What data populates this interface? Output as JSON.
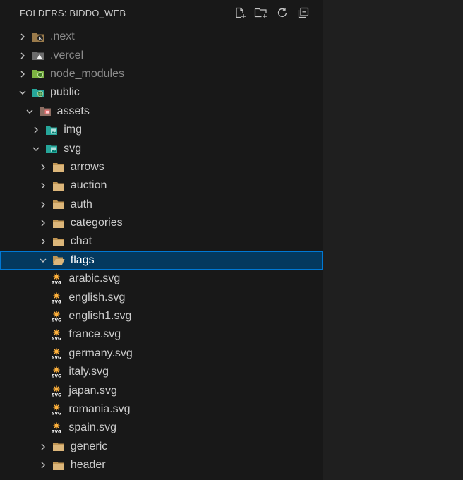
{
  "explorer": {
    "title": "FOLDERS: BIDDO_WEB",
    "actions": [
      {
        "name": "new-file-icon"
      },
      {
        "name": "new-folder-icon"
      },
      {
        "name": "refresh-icon"
      },
      {
        "name": "collapse-all-icon"
      }
    ]
  },
  "tree": [
    {
      "label": ".next",
      "depth": 0,
      "type": "folder",
      "expanded": false,
      "dimmed": true,
      "icon": "next-folder-icon"
    },
    {
      "label": ".vercel",
      "depth": 0,
      "type": "folder",
      "expanded": false,
      "dimmed": true,
      "icon": "vercel-folder-icon"
    },
    {
      "label": "node_modules",
      "depth": 0,
      "type": "folder",
      "expanded": false,
      "dimmed": true,
      "icon": "node-folder-icon"
    },
    {
      "label": "public",
      "depth": 0,
      "type": "folder",
      "expanded": true,
      "dimmed": false,
      "icon": "public-folder-icon"
    },
    {
      "label": "assets",
      "depth": 1,
      "type": "folder",
      "expanded": true,
      "dimmed": false,
      "icon": "assets-folder-icon"
    },
    {
      "label": "img",
      "depth": 2,
      "type": "folder",
      "expanded": false,
      "dimmed": false,
      "icon": "images-folder-icon"
    },
    {
      "label": "svg",
      "depth": 2,
      "type": "folder",
      "expanded": true,
      "dimmed": false,
      "icon": "images-folder-icon"
    },
    {
      "label": "arrows",
      "depth": 3,
      "type": "folder",
      "expanded": false,
      "dimmed": false,
      "icon": "folder-icon"
    },
    {
      "label": "auction",
      "depth": 3,
      "type": "folder",
      "expanded": false,
      "dimmed": false,
      "icon": "folder-icon"
    },
    {
      "label": "auth",
      "depth": 3,
      "type": "folder",
      "expanded": false,
      "dimmed": false,
      "icon": "folder-icon"
    },
    {
      "label": "categories",
      "depth": 3,
      "type": "folder",
      "expanded": false,
      "dimmed": false,
      "icon": "folder-icon"
    },
    {
      "label": "chat",
      "depth": 3,
      "type": "folder",
      "expanded": false,
      "dimmed": false,
      "icon": "folder-icon"
    },
    {
      "label": "flags",
      "depth": 3,
      "type": "folder",
      "expanded": true,
      "dimmed": false,
      "icon": "open-folder-icon",
      "selected": true
    },
    {
      "label": "arabic.svg",
      "depth": 4,
      "type": "file",
      "icon": "svg-file-icon"
    },
    {
      "label": "english.svg",
      "depth": 4,
      "type": "file",
      "icon": "svg-file-icon"
    },
    {
      "label": "english1.svg",
      "depth": 4,
      "type": "file",
      "icon": "svg-file-icon"
    },
    {
      "label": "france.svg",
      "depth": 4,
      "type": "file",
      "icon": "svg-file-icon"
    },
    {
      "label": "germany.svg",
      "depth": 4,
      "type": "file",
      "icon": "svg-file-icon"
    },
    {
      "label": "italy.svg",
      "depth": 4,
      "type": "file",
      "icon": "svg-file-icon"
    },
    {
      "label": "japan.svg",
      "depth": 4,
      "type": "file",
      "icon": "svg-file-icon"
    },
    {
      "label": "romania.svg",
      "depth": 4,
      "type": "file",
      "icon": "svg-file-icon"
    },
    {
      "label": "spain.svg",
      "depth": 4,
      "type": "file",
      "icon": "svg-file-icon"
    },
    {
      "label": "generic",
      "depth": 3,
      "type": "folder",
      "expanded": false,
      "dimmed": false,
      "icon": "folder-icon"
    },
    {
      "label": "header",
      "depth": 3,
      "type": "folder",
      "expanded": false,
      "dimmed": false,
      "icon": "folder-icon"
    }
  ],
  "colors": {
    "background": "#181818",
    "selection": "#04395e",
    "selection_border": "#0078d4",
    "folder": "#c09553",
    "svg_icon": "#ffb13b"
  }
}
